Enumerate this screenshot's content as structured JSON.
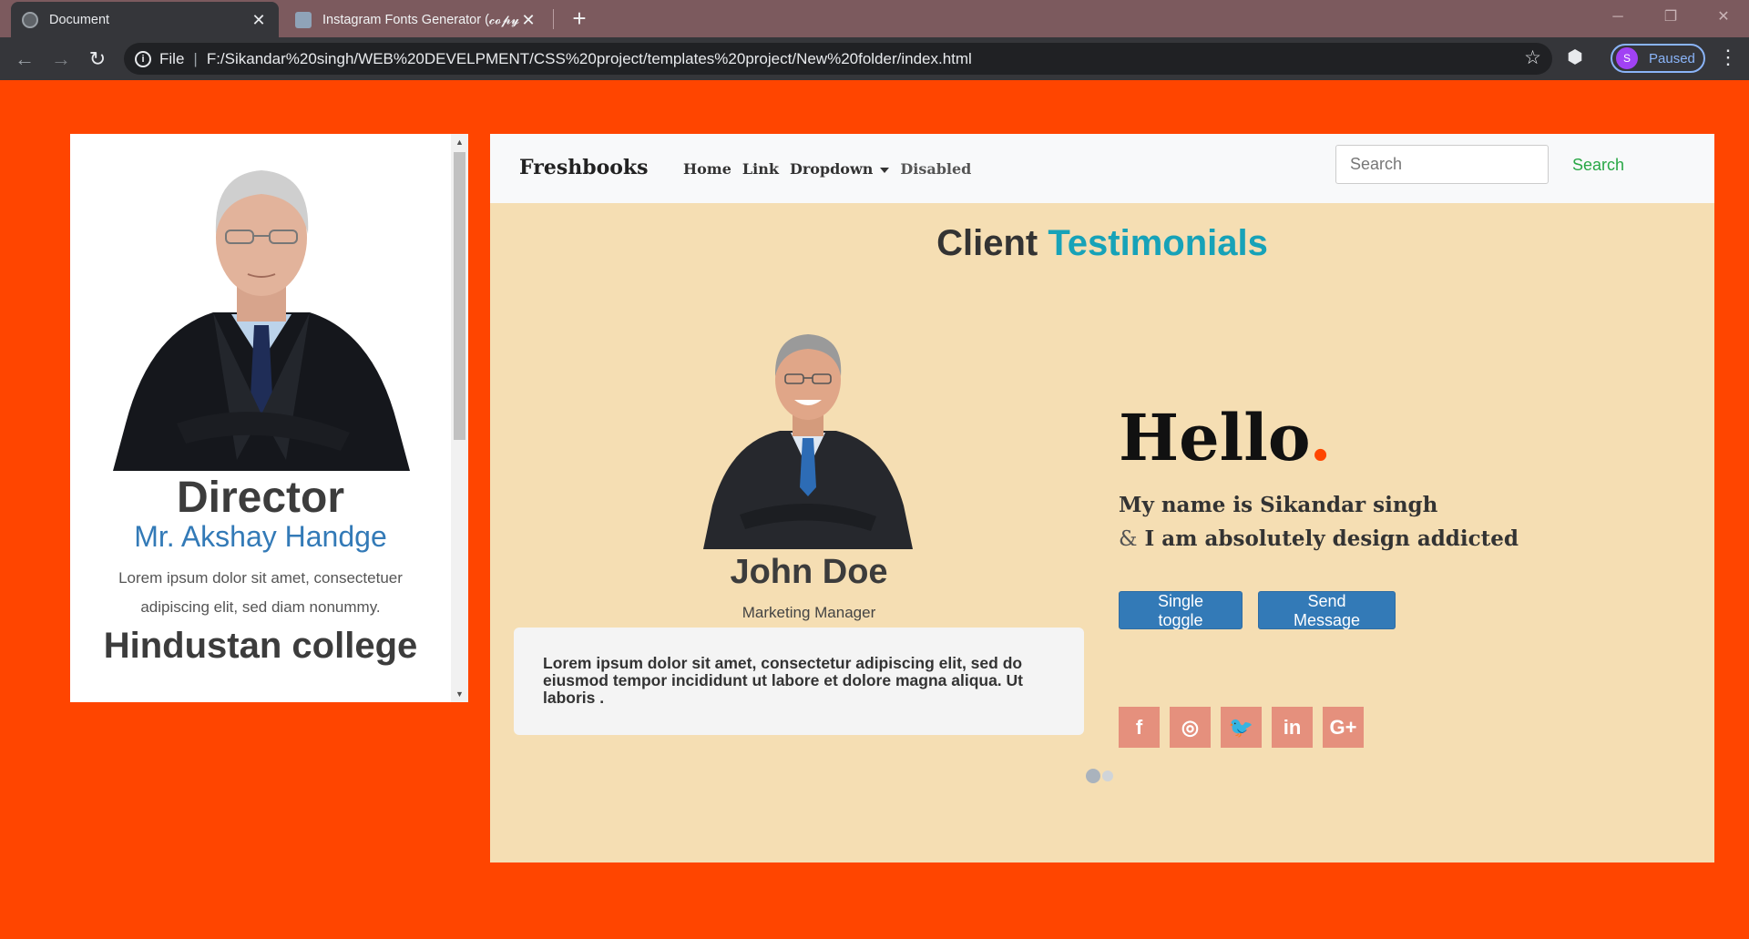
{
  "browser": {
    "tabs": [
      {
        "title": "Document",
        "close": "✕"
      },
      {
        "title": "Instagram Fonts Generator (𝓬𝓸𝓹𝔂",
        "close": "✕"
      }
    ],
    "new_tab": "+",
    "window_controls": {
      "minimize": "─",
      "restore": "❐",
      "close": "✕"
    },
    "nav": {
      "back": "←",
      "forward": "→",
      "reload": "↻"
    },
    "address": {
      "info": "i",
      "scheme_label": "File",
      "separator": "|",
      "url": "F:/Sikandar%20singh/WEB%20DEVELPMENT/CSS%20project/templates%20project/New%20folder/index.html"
    },
    "star_icon": "☆",
    "extension_icon": "⬢",
    "profile": {
      "initial": "S",
      "status": "Paused"
    },
    "menu_icon": "⋮"
  },
  "left_card": {
    "role": "Director",
    "name": "Mr. Akshay Handge",
    "blurb": "Lorem ipsum dolor sit amet, consectetuer adipiscing elit, sed diam nonummy.",
    "college": "Hindustan college",
    "scroll_up": "▲",
    "scroll_down": "▼"
  },
  "navbar": {
    "brand": "Freshbooks",
    "links": [
      "Home",
      "Link",
      "Dropdown",
      "Disabled"
    ],
    "search_placeholder": "Search",
    "search_button": "Search"
  },
  "section": {
    "title_part1": "Client",
    "title_part2": "Testimonials"
  },
  "testimonial": {
    "name": "John Doe",
    "role": "Marketing Manager",
    "quote": "Lorem ipsum dolor sit amet, consectetur adipiscing elit, sed do eiusmod tempor incididunt ut labore et dolore magna aliqua. Ut laboris ."
  },
  "intro": {
    "greeting": "Hello",
    "greeting_dot": ".",
    "line1": "My name is Sikandar singh",
    "line2_amp": "&",
    "line2": "I am absolutely design addicted",
    "btn_toggle": "Single toggle",
    "btn_send": "Send Message"
  },
  "socials": [
    {
      "name": "facebook",
      "glyph": "f"
    },
    {
      "name": "instagram",
      "glyph": "◎"
    },
    {
      "name": "twitter",
      "glyph": "🐦"
    },
    {
      "name": "linkedin",
      "glyph": "in"
    },
    {
      "name": "google-plus",
      "glyph": "G+"
    }
  ],
  "colors": {
    "page_bg": "#ff4500",
    "panel_bg": "#f5deb3",
    "accent_teal": "#17a2b8",
    "button_blue": "#337ab7",
    "search_green": "#28a745",
    "social_bg": "#e5907d"
  }
}
